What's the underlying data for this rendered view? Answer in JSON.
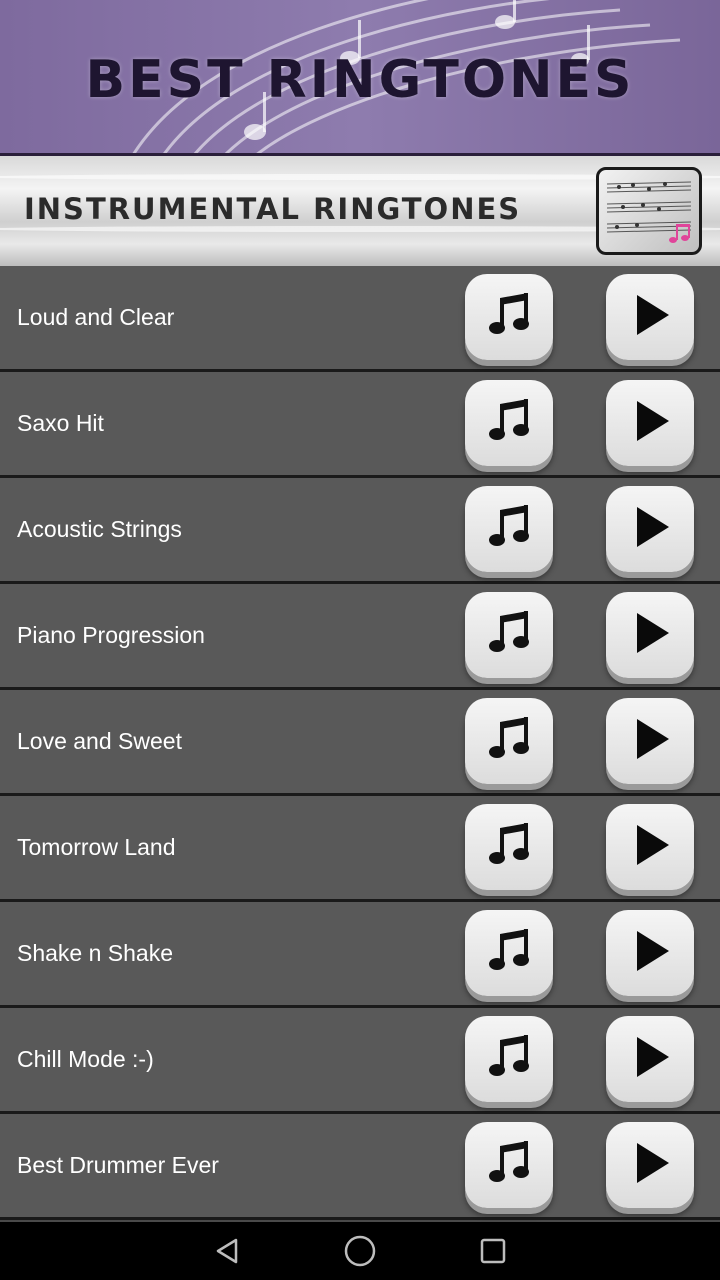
{
  "header": {
    "title": "BEST RINGTONES"
  },
  "banner": {
    "title": "INSTRUMENTAL RINGTONES"
  },
  "ringtones": [
    {
      "name": "Loud and Clear"
    },
    {
      "name": "Saxo Hit"
    },
    {
      "name": "Acoustic Strings"
    },
    {
      "name": "Piano Progression"
    },
    {
      "name": "Love and Sweet"
    },
    {
      "name": "Tomorrow Land"
    },
    {
      "name": "Shake n Shake"
    },
    {
      "name": "Chill Mode :-)"
    },
    {
      "name": "Best Drummer Ever"
    }
  ],
  "icons": {
    "set_ringtone": "music-note-icon",
    "play": "play-icon",
    "nav_back": "back-triangle-icon",
    "nav_home": "home-circle-icon",
    "nav_recents": "recents-square-icon"
  },
  "colors": {
    "header_bg": "#8e7cae",
    "title": "#1e1530",
    "row_bg": "#595959",
    "row_divider": "#1a1a1a",
    "button_face": "#e6e6e6"
  }
}
